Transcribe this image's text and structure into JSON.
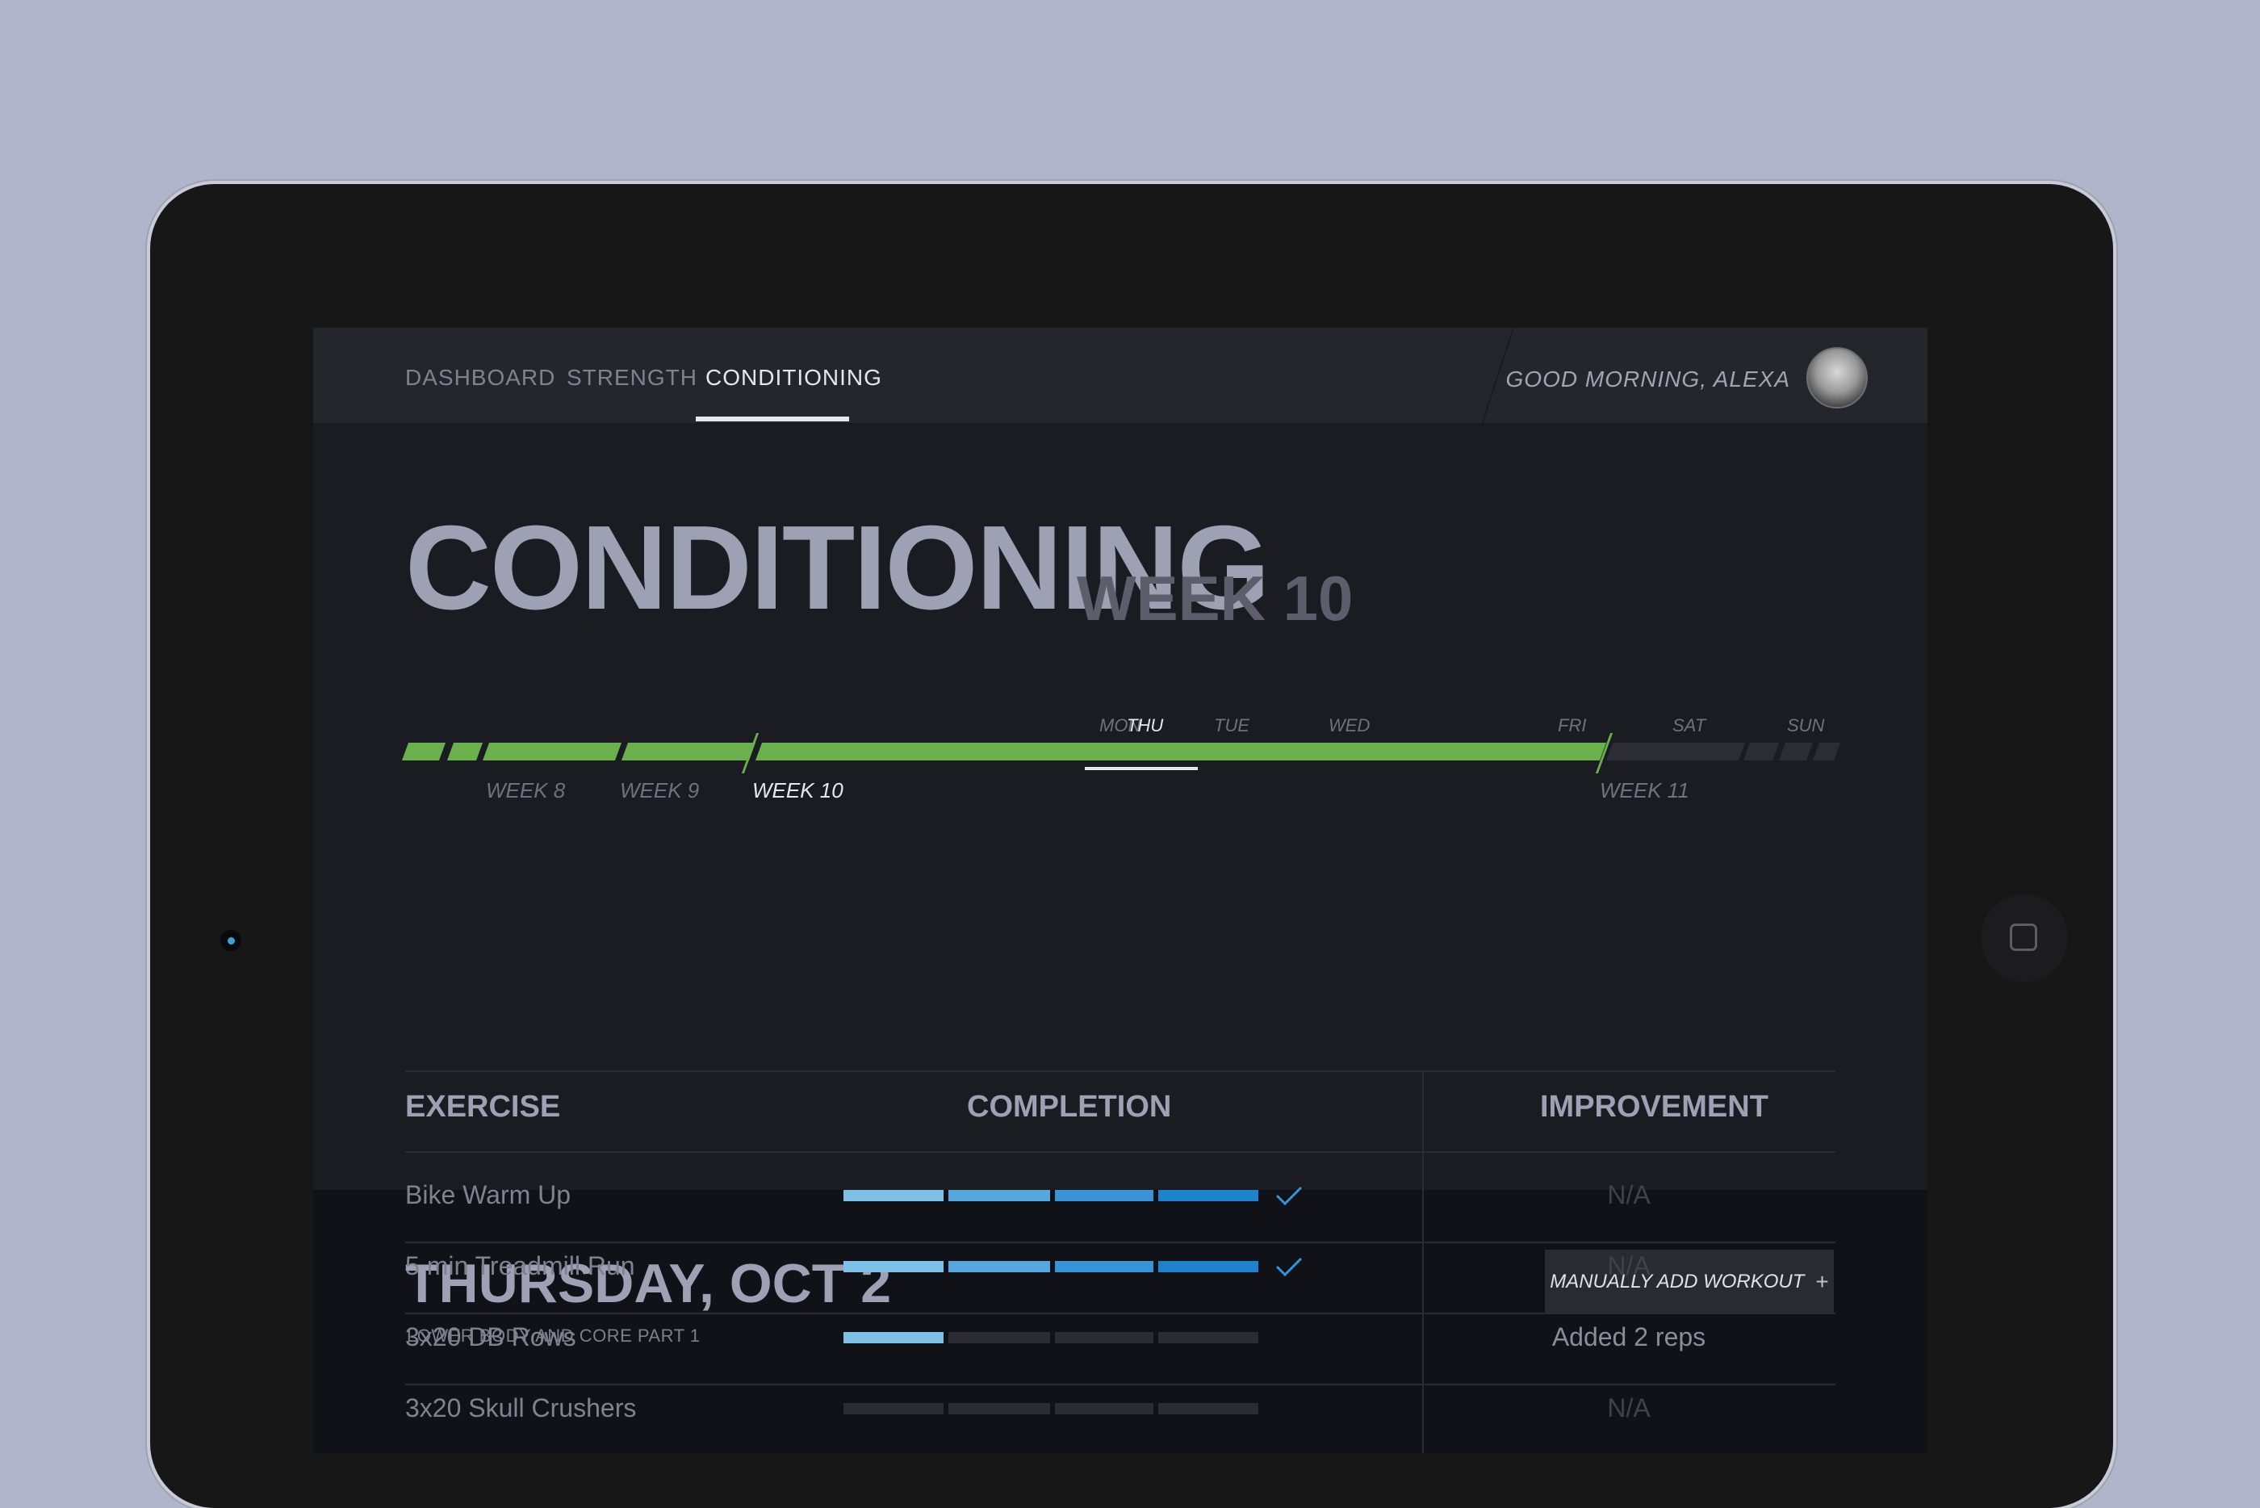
{
  "nav": {
    "items": [
      {
        "label": "DASHBOARD",
        "active": false
      },
      {
        "label": "STRENGTH",
        "active": false
      },
      {
        "label": "CONDITIONING",
        "active": true
      }
    ],
    "greeting": "GOOD MORNING, ALEXA"
  },
  "hero": {
    "title": "CONDITIONING",
    "week": "WEEK 10",
    "days": [
      "MON",
      "TUE",
      "WED",
      "THU",
      "FRI",
      "SAT",
      "SUN"
    ],
    "active_day": "THU",
    "weeks": [
      "WEEK 8",
      "WEEK 9",
      "WEEK 10",
      "WEEK 11"
    ],
    "active_week": "WEEK 10"
  },
  "day": {
    "title": "THURSDAY, OCT 2",
    "subtitle": "LOWER BODY AND CORE PART 1",
    "add_button": "MANUALLY ADD WORKOUT",
    "add_icon": "+"
  },
  "table": {
    "headers": {
      "exercise": "EXERCISE",
      "completion": "COMPLETION",
      "improvement": "IMPROVEMENT"
    },
    "rows": [
      {
        "exercise": "Bike Warm Up",
        "completion_segments_filled": 4,
        "completion_segments_total": 4,
        "completed": true,
        "improvement": "N/A"
      },
      {
        "exercise": "5 min Treadmill Run",
        "completion_segments_filled": 4,
        "completion_segments_total": 4,
        "completed": true,
        "improvement": "N/A"
      },
      {
        "exercise": "3x20 DB Rows",
        "completion_segments_filled": 1,
        "completion_segments_total": 4,
        "completed": false,
        "improvement": "Added 2 reps"
      },
      {
        "exercise": "3x20 Skull Crushers",
        "completion_segments_filled": 0,
        "completion_segments_total": 4,
        "completed": false,
        "improvement": "N/A"
      }
    ]
  },
  "colors": {
    "accent_green": "#6ab04c",
    "bar_blue": "#1f82cc",
    "text_muted": "#808291"
  },
  "icons": {
    "check": "checkmark-icon",
    "home": "home-button-icon",
    "camera": "camera-icon",
    "avatar": "user-avatar"
  }
}
